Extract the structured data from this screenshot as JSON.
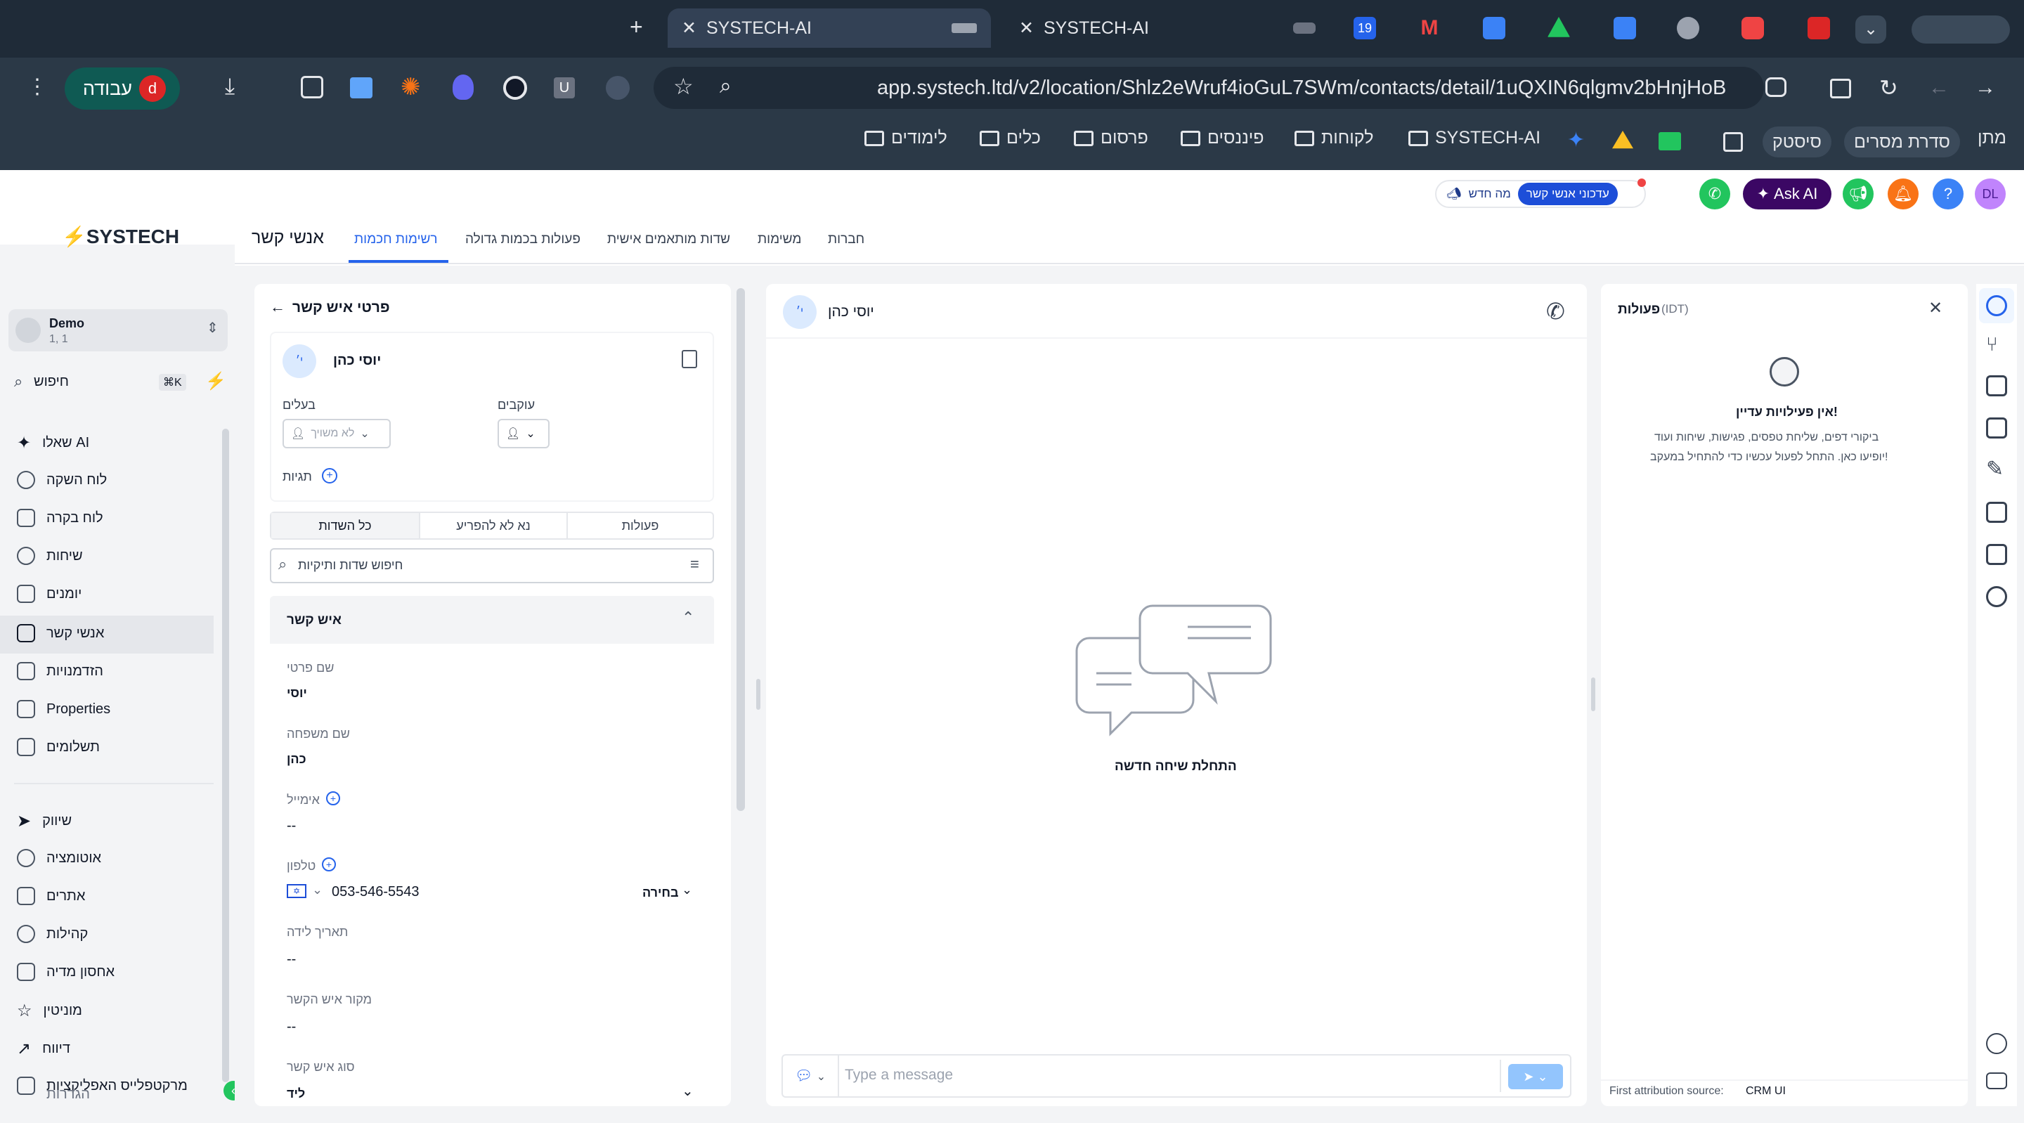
{
  "browser": {
    "tabs": [
      {
        "title": "SYSTECH-AI",
        "close": "✕"
      },
      {
        "title": "SYSTECH-AI",
        "close": "✕"
      }
    ],
    "new_tab": "+",
    "tab_icon_calendar": "19",
    "url": "app.systech.ltd/v2/location/Shlz2eWruf4ioGuL7SWm/contacts/detail/1uQXIN6qlgmv2bHnjHoB",
    "profile_label": "עבודה",
    "profile_initial": "d",
    "ext_u": "U",
    "bookmarks": [
      "מתן",
      "סדרת מסרים",
      "סיסטק",
      "SYSTECH-AI",
      "לקוחות",
      "פיננסים",
      "פרסום",
      "כלים",
      "לימודים"
    ]
  },
  "app": {
    "logo": "SYSTECH",
    "account": {
      "name": "Demo",
      "sub": "1, 1"
    },
    "search": {
      "placeholder": "חיפוש",
      "shortcut": "⌘K"
    },
    "nav": [
      "שאלו AI",
      "לוח השקה",
      "לוח בקרה",
      "שיחות",
      "יומנים",
      "אנשי קשר",
      "הזדמנויות",
      "Properties",
      "תשלומים"
    ],
    "nav2": [
      "שיווק",
      "אוטומציה",
      "אתרים",
      "קהילות",
      "אחסון מדיה",
      "מוניטין",
      "דיווח",
      "מרקטפלייס האפליקציות",
      "הגדרות"
    ],
    "topbar": {
      "news_badge": "מה חדש",
      "update_badge": "עדכוני אנשי קשר",
      "ask_ai": "Ask AI",
      "avatar": "DL",
      "help": "?"
    },
    "page_title": "אנשי קשר",
    "tabs": [
      "רשימות חכמות",
      "פעולות בכמות גדולה",
      "שדות מותאמים אישית",
      "משימות",
      "חברות"
    ]
  },
  "details": {
    "header": "פרטי איש קשר",
    "contact_name": "יוסי כהן",
    "avatar_initials": "י׳",
    "owner_label": "בעלים",
    "owner_placeholder": "לא משויך",
    "followers_label": "עוקבים",
    "tags_label": "תגיות",
    "seg": [
      "כל השדות",
      "נא לא להפריע",
      "פעולות"
    ],
    "field_search": "חיפוש שדות ותיקיות",
    "section": "איש קשר",
    "fields": {
      "first_name_label": "שם פרטי",
      "first_name": "יוסי",
      "last_name_label": "שם משפחה",
      "last_name": "כהן",
      "email_label": "אימייל",
      "email": "--",
      "phone_label": "טלפון",
      "phone": "053-546-5543",
      "phone_type": "בחירה",
      "birthday_label": "תאריך לידה",
      "birthday": "--",
      "source_label": "מקור איש הקשר",
      "source": "--",
      "type_label": "סוג איש קשר",
      "type": "ליד"
    }
  },
  "conversation": {
    "contact_name": "יוסי כהן",
    "avatar_initials": "י׳",
    "empty_text": "התחלת שיחה חדשה",
    "message_placeholder": "Type a message"
  },
  "activity": {
    "title": "פעולות",
    "tz": "(IDT)",
    "empty_title": "אין פעילויות עדיין!",
    "empty_line1": "ביקורי דפים, שליחת טפסים, פגישות, שיחות ועוד",
    "empty_line2": "יופיעו כאן. התחל לפעול עכשיו כדי להתחיל במעקב!",
    "attribution_label": "First attribution source:",
    "attribution_value": "CRM UI"
  },
  "colors": {
    "accent": "#2563eb",
    "brand_purple": "#4c1d95",
    "green": "#22c55e"
  }
}
